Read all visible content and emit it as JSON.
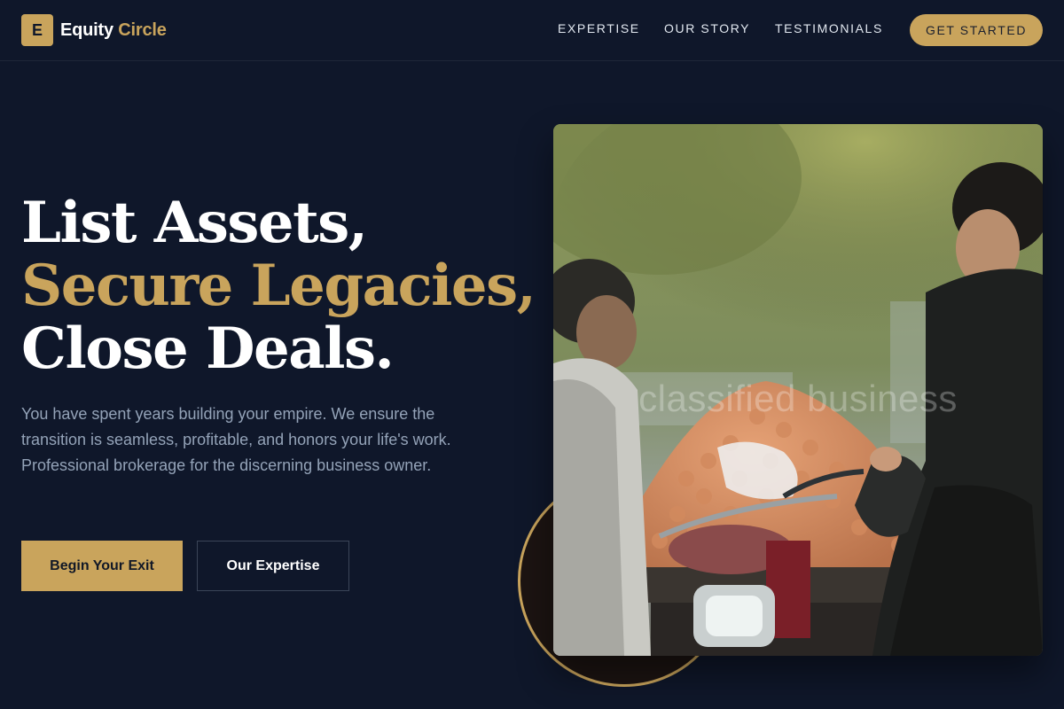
{
  "nav": {
    "brand_mark": "E",
    "brand_name": "Equity",
    "brand_accent": "Circle",
    "links": [
      "EXPERTISE",
      "OUR STORY",
      "TESTIMONIALS"
    ],
    "cta_label": "GET STARTED"
  },
  "hero": {
    "headline_line1": "List Assets,",
    "headline_line2": "Secure Legacies,",
    "headline_line3": "Close Deals.",
    "description": "You have spent years building your empire. We ensure the transition is seamless, profitable, and honors your life's work. Professional brokerage for the discerning business owner.",
    "primary_button": "Begin Your Exit",
    "secondary_button": "Our Expertise",
    "image_watermark": "classified business"
  },
  "colors": {
    "background": "#0f172a",
    "accent": "#c9a45c",
    "body_text": "#94a3b8",
    "heading_text": "#ffffff"
  }
}
